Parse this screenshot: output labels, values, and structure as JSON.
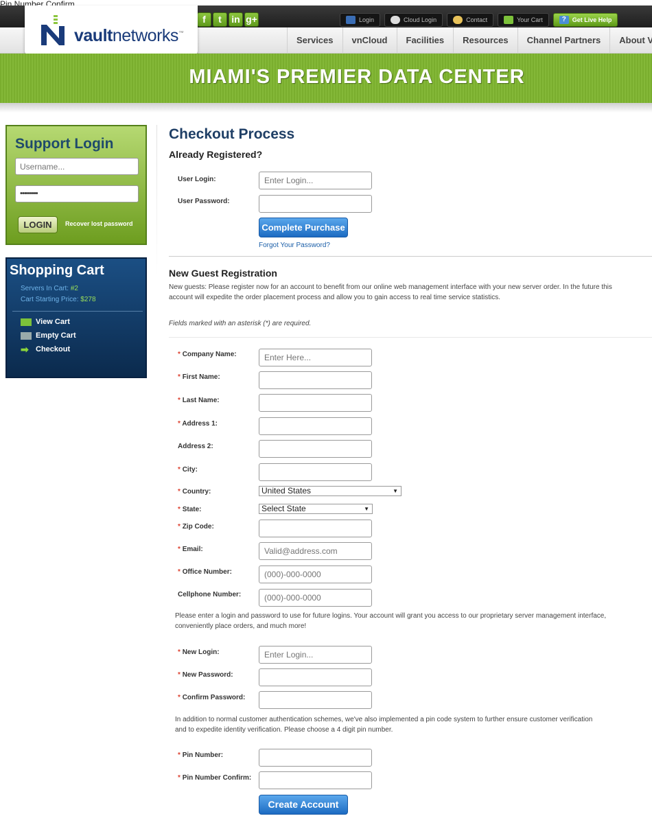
{
  "caption": "Pin Number Confirm",
  "brand": {
    "name_bold": "vault",
    "name_light": "networks",
    "tm": "™"
  },
  "social": [
    "f",
    "t",
    "in",
    "g+"
  ],
  "toplinks": [
    "Login",
    "Cloud Login",
    "Contact",
    "Your Cart",
    "Get Live Help"
  ],
  "nav": [
    "Services",
    "vnCloud",
    "Facilities",
    "Resources",
    "Channel Partners",
    "About VN"
  ],
  "banner": "MIAMI'S PREMIER DATA CENTER",
  "support": {
    "title": "Support Login",
    "username_placeholder": "Username...",
    "password_value": "•••••••••",
    "login_label": "LOGIN",
    "recover_label": "Recover lost password"
  },
  "cart": {
    "title": "Shopping Cart",
    "servers_label": "Servers In Cart:",
    "servers_value": "#2",
    "price_label": "Cart Starting Price:",
    "price_value": "$278",
    "items": [
      "View Cart",
      "Empty Cart",
      "Checkout"
    ]
  },
  "checkout": {
    "title": "Checkout Process",
    "registered_heading": "Already Registered?",
    "user_login_label": "User Login:",
    "user_login_placeholder": "Enter Login...",
    "user_password_label": "User Password:",
    "complete_label": "Complete Purchase",
    "forgot_label": "Forgot Your Password?",
    "guest_heading": "New Guest Registration",
    "guest_text_1": "New guests: Please register now for an account to benefit from our online web management interface with your new server order. In the future this",
    "guest_text_2": "account will expedite the order placement process and allow you to gain access to real time service statistics.",
    "required_note": "Fields marked with an asterisk (*) are required.",
    "company_label": "Company Name:",
    "company_placeholder": "Enter Here...",
    "first_label": "First Name:",
    "last_label": "Last Name:",
    "addr1_label": "Address 1:",
    "addr2_label": "Address 2:",
    "city_label": "City:",
    "country_label": "Country:",
    "country_value": "United States",
    "state_label": "State:",
    "state_value": "Select State",
    "zip_label": "Zip Code:",
    "email_label": "Email:",
    "email_placeholder": "Valid@address.com",
    "office_label": "Office Number:",
    "office_placeholder": "(000)-000-0000",
    "cell_label": "Cellphone Number:",
    "cell_placeholder": "(000)-000-0000",
    "login_text_1": "Please enter a login and password to use for future logins. Your account will grant you access to our proprietary server management interface,",
    "login_text_2": "conveniently place orders, and much more!",
    "new_login_label": "New Login:",
    "new_login_placeholder": "Enter Login...",
    "new_password_label": "New Password:",
    "confirm_password_label": "Confirm Password:",
    "pin_text_1": "In addition to normal customer authentication schemes, we've also implemented a pin code system to further ensure customer verification",
    "pin_text_2": "and to expedite identity verification. Please choose a 4 digit pin number.",
    "pin_label": "Pin Number:",
    "pin_confirm_label": "Pin Number Confirm:",
    "create_label": "Create Account",
    "asterisk": "*"
  }
}
